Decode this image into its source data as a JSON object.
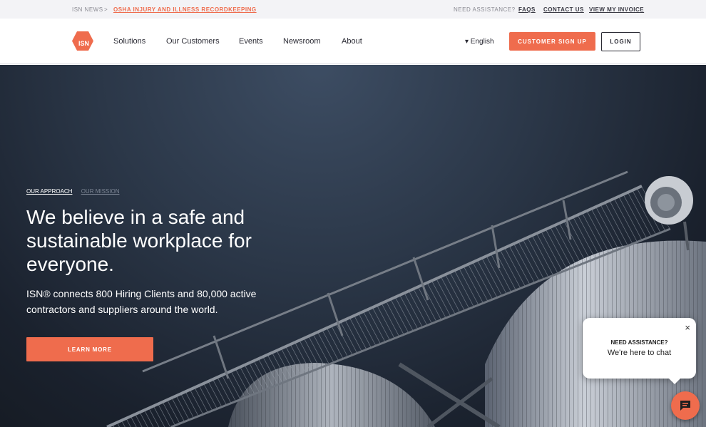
{
  "topbar": {
    "news_label": "ISN NEWS",
    "news_separator": ">",
    "news_link": "OSHA INJURY AND ILLNESS RECORDKEEPING",
    "assistance_label": "NEED ASSISTANCE?",
    "faqs": "FAQS",
    "contact": "CONTACT US",
    "invoice": "VIEW MY INVOICE"
  },
  "nav": {
    "logo_text": "ISN",
    "items": [
      "Solutions",
      "Our Customers",
      "Events",
      "Newsroom",
      "About"
    ],
    "language": "▾ English",
    "signup": "CUSTOMER SIGN UP",
    "login": "LOGIN"
  },
  "hero": {
    "tabs": [
      "OUR APPROACH",
      "OUR MISSION"
    ],
    "title": "We believe in a safe and sustainable workplace for everyone.",
    "subtitle": "ISN® connects 800 Hiring Clients and 80,000 active contractors and suppliers around the world.",
    "cta": "LEARN MORE"
  },
  "chat": {
    "close": "×",
    "heading": "NEED ASSISTANCE?",
    "text": "We're here to chat"
  },
  "colors": {
    "accent": "#ef6c4d",
    "hero_dark": "#1a212d"
  },
  "icons": [
    "logo-hexagon-icon",
    "chevron-down-icon",
    "close-icon",
    "chat-icon"
  ]
}
